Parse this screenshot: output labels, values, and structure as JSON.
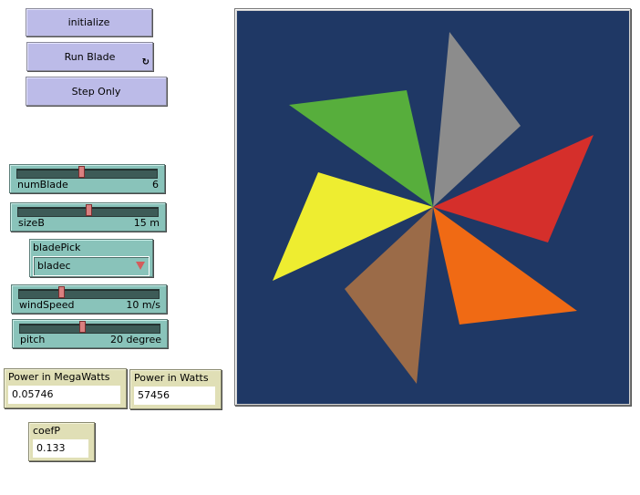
{
  "buttons": {
    "initialize": "initialize",
    "run_blade": "Run Blade",
    "step_only": "Step Only"
  },
  "icons": {
    "forever": "forever-loop-icon"
  },
  "sliders": [
    {
      "name": "numBlade",
      "value": "6",
      "fraction": 0.45
    },
    {
      "name": "sizeB",
      "value": "15 m",
      "fraction": 0.5
    },
    {
      "name": "windSpeed",
      "value": "10 m/s",
      "fraction": 0.29
    },
    {
      "name": "pitch",
      "value": "20 degree",
      "fraction": 0.44
    }
  ],
  "chooser": {
    "label": "bladePick",
    "selected": "bladec"
  },
  "monitors": {
    "power_mw": {
      "label": "Power in MegaWatts",
      "value": "0.05746"
    },
    "power_w": {
      "label": "Power in Watts",
      "value": "57456"
    },
    "coefp": {
      "label": "coefP",
      "value": "0.133"
    }
  },
  "view": {
    "background": "#1f3865",
    "blades": [
      {
        "color": "#8c8c8c",
        "name": "gray"
      },
      {
        "color": "#d52f2b",
        "name": "red"
      },
      {
        "color": "#f06a14",
        "name": "orange"
      },
      {
        "color": "#9b6b48",
        "name": "brown"
      },
      {
        "color": "#eeed30",
        "name": "yellow"
      },
      {
        "color": "#57ae3c",
        "name": "green"
      }
    ]
  }
}
